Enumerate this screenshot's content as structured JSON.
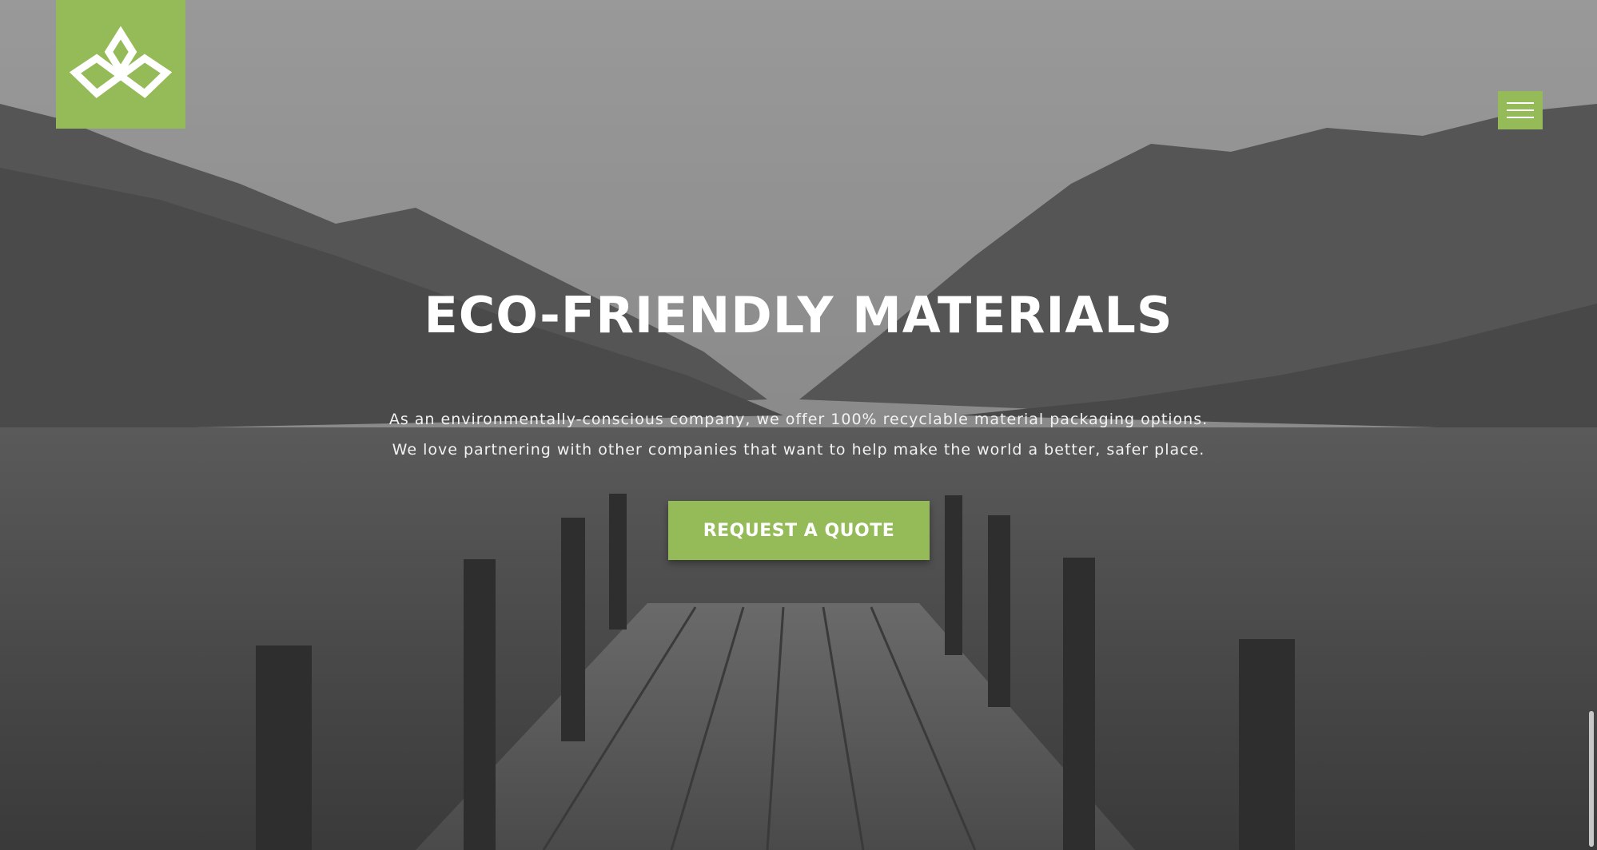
{
  "header": {
    "logo_icon": "leaf-diamond-logo",
    "menu_icon": "hamburger-icon"
  },
  "hero": {
    "title": "ECO-FRIENDLY MATERIALS",
    "description_line1": "As an environmentally-conscious company, we offer 100% recyclable material packaging options.",
    "description_line2": "We love partnering with other companies that want to help make the world a better, safer place.",
    "cta_label": "REQUEST A QUOTE"
  },
  "colors": {
    "accent": "#95ba58",
    "text": "#ffffff"
  }
}
